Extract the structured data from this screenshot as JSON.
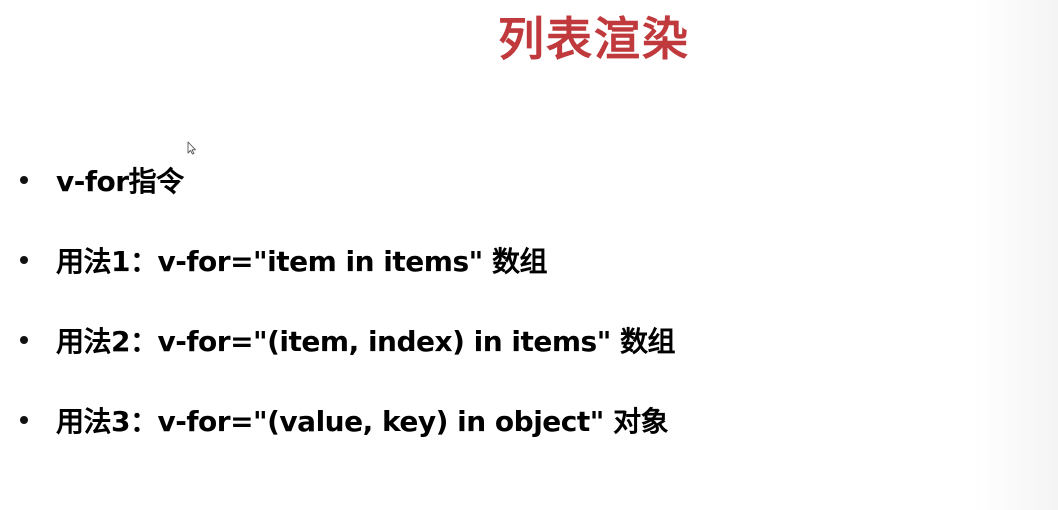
{
  "slide": {
    "title": "列表渲染",
    "bullets": [
      {
        "text": "v-for指令"
      },
      {
        "text": "用法1：v-for=\"item in items\"  数组"
      },
      {
        "text": "用法2：v-for=\"(item, index) in items\"  数组"
      },
      {
        "text": "用法3：v-for=\"(value, key) in object\"  对象"
      }
    ]
  },
  "colors": {
    "title": "#c0393d",
    "text": "#000000",
    "background": "#ffffff"
  },
  "icons": {
    "cursor": "mouse-pointer-icon",
    "bullet": "bullet-dot-icon"
  }
}
